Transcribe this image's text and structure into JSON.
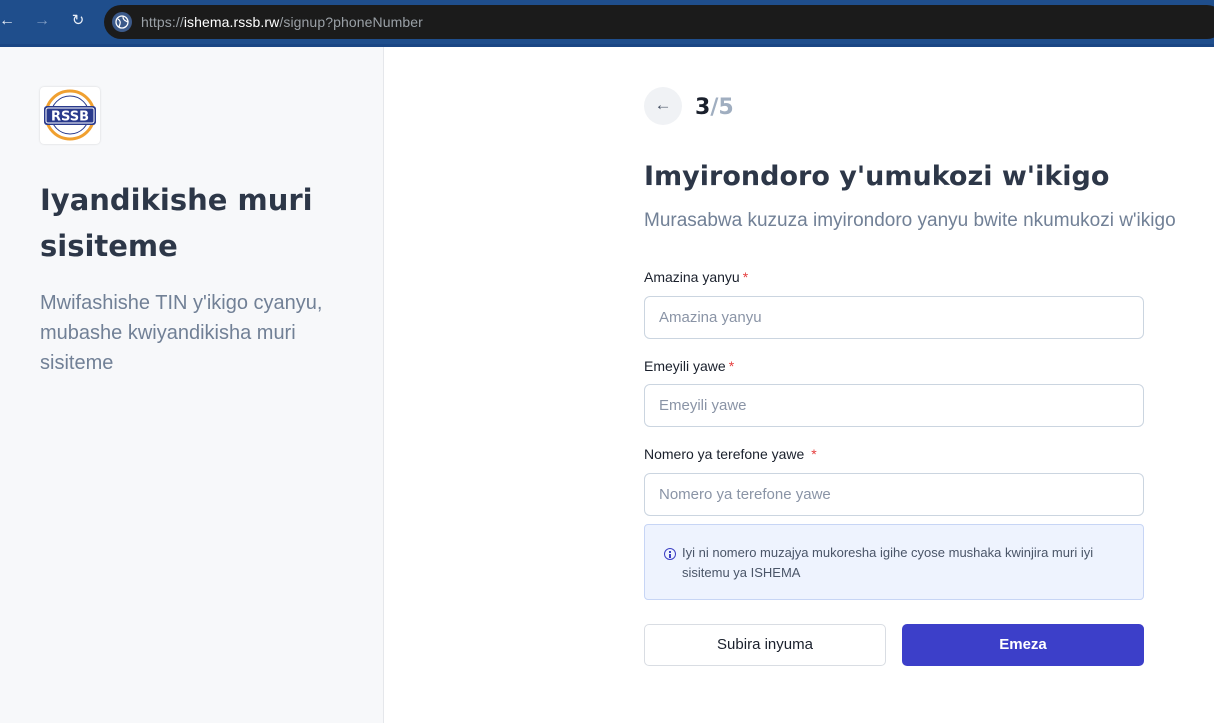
{
  "browser": {
    "url_prefix": "https://",
    "url_host": "ishema.rssb.rw",
    "url_path": "/signup?phoneNumber"
  },
  "sidebar": {
    "logo_text": "RSSB",
    "title": "Iyandikishe muri sisiteme",
    "subtitle": "Mwifashishe TIN y'ikigo cyanyu, mubashe kwiyandikisha muri sisiteme"
  },
  "step": {
    "current": "3",
    "total": "/5"
  },
  "form": {
    "title": "Imyirondoro y'umukozi w'ikigo",
    "subtitle": "Murasabwa kuzuza imyirondoro yanyu bwite nkumukozi w'ikigo",
    "fields": [
      {
        "label": "Amazina yanyu",
        "required_mark": "*",
        "placeholder": "Amazina yanyu",
        "value": ""
      },
      {
        "label": "Emeyili yawe",
        "required_mark": "*",
        "placeholder": "Emeyili yawe",
        "value": ""
      },
      {
        "label": "Nomero ya terefone yawe ",
        "required_mark": "*",
        "placeholder": "Nomero ya terefone yawe",
        "value": ""
      }
    ],
    "info_text": "Iyi ni nomero muzajya mukoresha igihe cyose mushaka kwinjira muri iyi sisitemu ya ISHEMA",
    "back_button": "Subira inyuma",
    "submit_button": "Emeza"
  },
  "colors": {
    "primary": "#3c3fc9",
    "required": "#e53e3e",
    "info_bg": "#eef3fe",
    "browser_bar": "#1f4e8c"
  },
  "icons": {
    "browser_back": "arrow-left-icon",
    "browser_forward": "arrow-right-icon",
    "browser_reload": "reload-icon",
    "site_info": "globe-icon",
    "step_back": "arrow-left-icon",
    "info": "info-circle-icon"
  }
}
